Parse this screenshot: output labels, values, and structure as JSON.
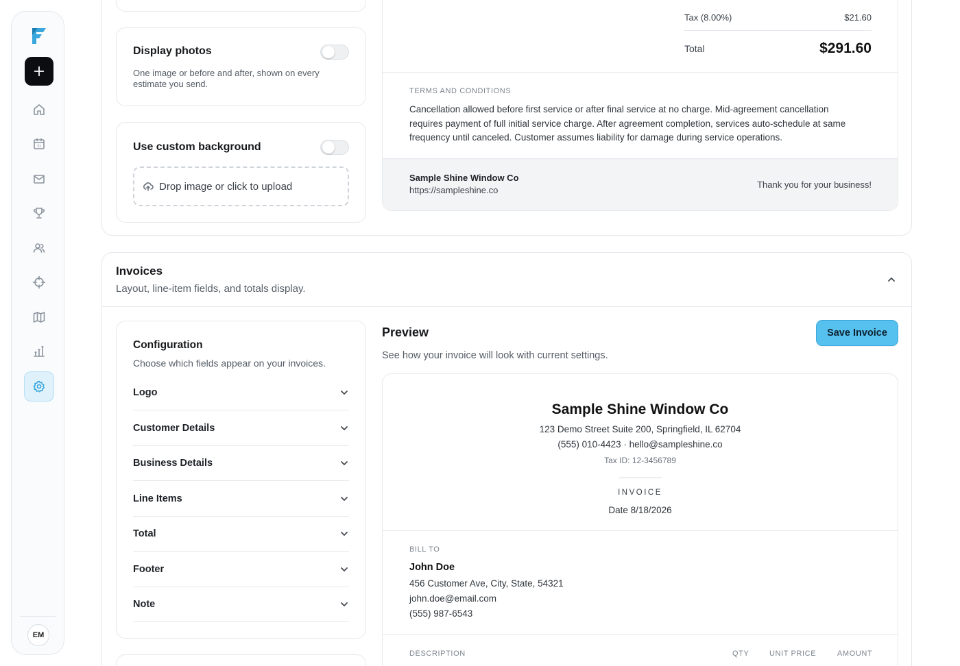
{
  "sidebar": {
    "logo_icon": "brand-logo-icon",
    "add_icon": "plus-icon",
    "nav": [
      {
        "name": "home",
        "icon": "home-icon"
      },
      {
        "name": "calendar",
        "icon": "calendar-icon",
        "text": "31"
      },
      {
        "name": "mail",
        "icon": "mail-icon"
      },
      {
        "name": "trophy",
        "icon": "trophy-icon"
      },
      {
        "name": "users",
        "icon": "users-icon"
      },
      {
        "name": "target",
        "icon": "crosshair-icon"
      },
      {
        "name": "map",
        "icon": "map-icon"
      },
      {
        "name": "reports",
        "icon": "bar-chart-icon"
      },
      {
        "name": "settings",
        "icon": "gear-icon",
        "active": true
      }
    ],
    "avatar_initials": "EM"
  },
  "colors": {
    "accent": "#56c0ee",
    "accent_border": "#3aa9dc",
    "active_nav_bg": "#dff1fb"
  },
  "estimates": {
    "display_photos": {
      "title": "Display photos",
      "description": "One image or before and after, shown on every estimate you send.",
      "enabled": false
    },
    "custom_background": {
      "title": "Use custom background",
      "enabled": false,
      "upload_label": "Drop image or click to upload"
    },
    "preview": {
      "tax_label": "Tax (8.00%)",
      "tax_value": "$21.60",
      "total_label": "Total",
      "total_value": "$291.60",
      "terms_label": "TERMS AND CONDITIONS",
      "terms_text": "Cancellation allowed before first service or after final service at no charge. Mid-agreement cancellation requires payment of full initial service charge. After agreement completion, services auto-schedule at same frequency until canceled. Customer assumes liability for damage during service operations.",
      "footer_company": "Sample Shine Window Co",
      "footer_url": "https://sampleshine.co",
      "footer_thanks": "Thank you for your business!"
    }
  },
  "invoices": {
    "title": "Invoices",
    "subtitle": "Layout, line-item fields, and totals display.",
    "configuration": {
      "title": "Configuration",
      "subtitle": "Choose which fields appear on your invoices.",
      "fields": [
        "Logo",
        "Customer Details",
        "Business Details",
        "Line Items",
        "Total",
        "Footer",
        "Note"
      ]
    },
    "preview": {
      "title": "Preview",
      "subtitle": "See how your invoice will look with current settings.",
      "save_button": "Save Invoice",
      "company_name": "Sample Shine Window Co",
      "address": "123 Demo Street Suite 200, Springfield, IL 62704",
      "contact": "(555) 010-4423 · hello@sampleshine.co",
      "tax_id": "Tax ID: 12-3456789",
      "doc_type": "INVOICE",
      "date": "Date 8/18/2026",
      "bill_to_label": "BILL TO",
      "customer_name": "John Doe",
      "customer_address": "456 Customer Ave, City, State, 54321",
      "customer_email": "john.doe@email.com",
      "customer_phone": "(555) 987-6543",
      "columns": [
        "DESCRIPTION",
        "QTY",
        "UNIT PRICE",
        "AMOUNT"
      ]
    }
  }
}
